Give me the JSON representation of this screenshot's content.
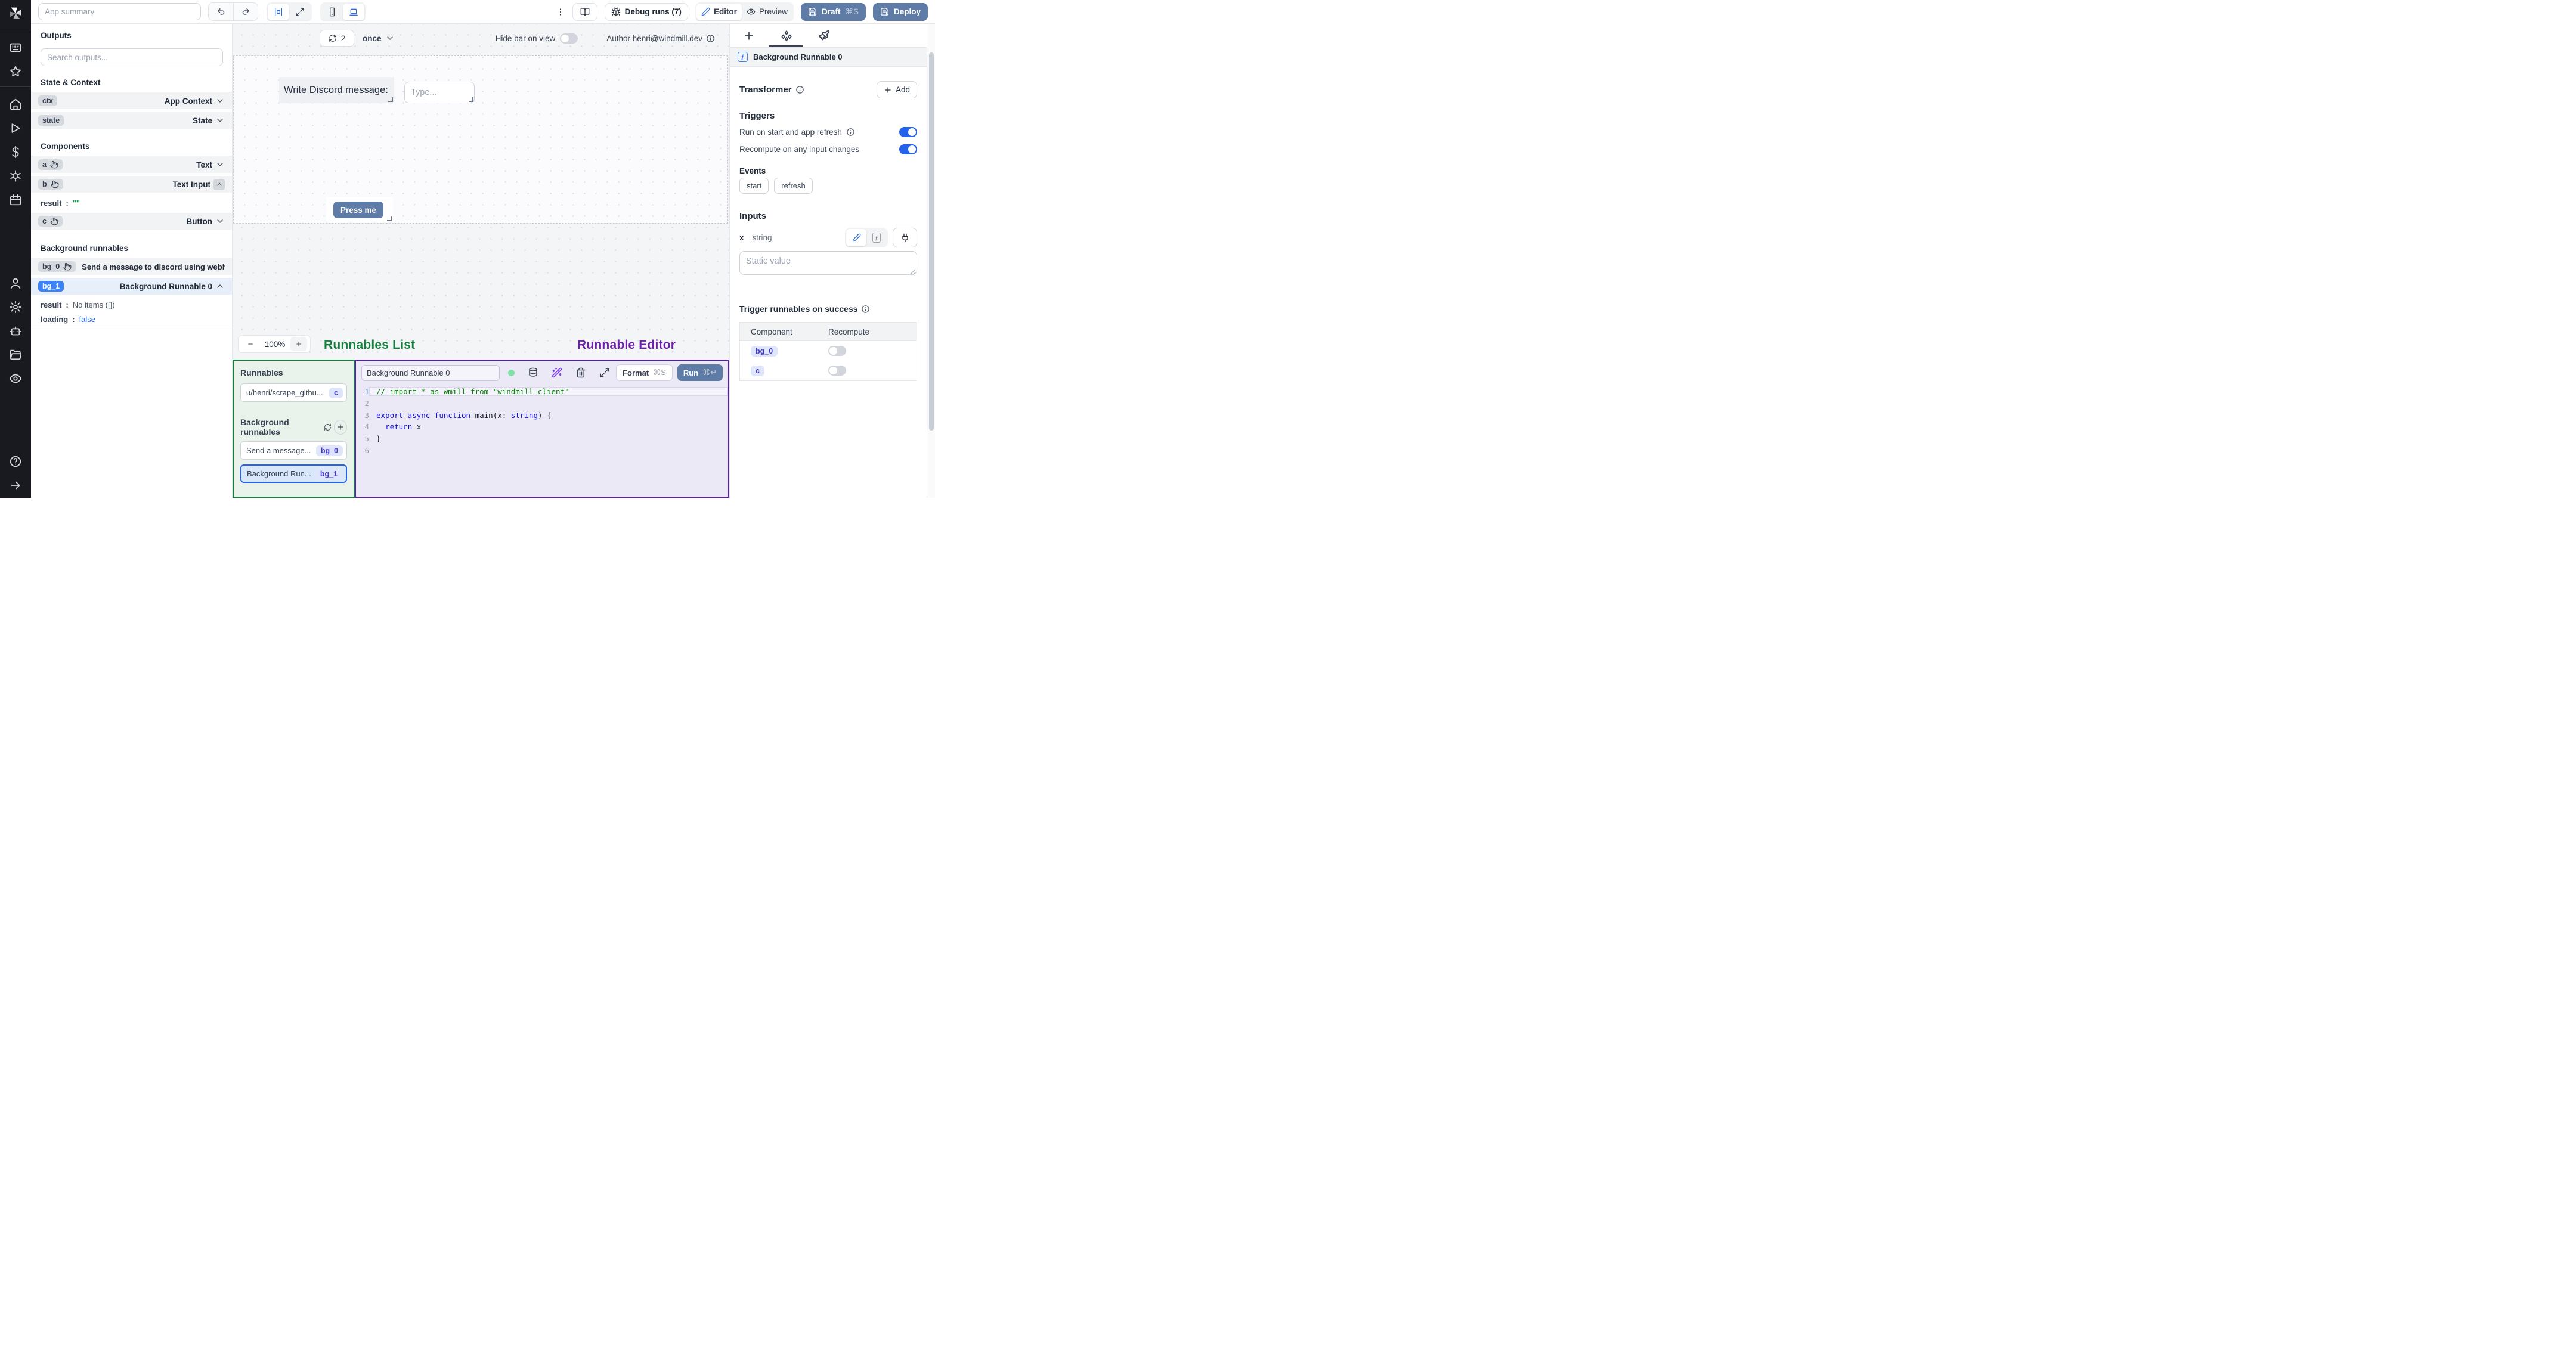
{
  "topbar": {
    "app_summary_placeholder": "App summary",
    "debug_runs_label": "Debug runs (7)",
    "editor_label": "Editor",
    "preview_label": "Preview",
    "draft_label": "Draft",
    "draft_shortcut": "⌘S",
    "deploy_label": "Deploy"
  },
  "canvas_bar": {
    "refresh_count": "2",
    "schedule": "once",
    "hide_bar_label": "Hide bar on view",
    "author_label": "Author henri@windmill.dev"
  },
  "canvas": {
    "text_component": "Write Discord message:",
    "input_placeholder": "Type...",
    "button_label": "Press me"
  },
  "zoom_control": {
    "minus": "−",
    "level": "100%",
    "plus": "+"
  },
  "annotations": {
    "runnables_list": "Runnables List",
    "runnable_editor": "Runnable Editor"
  },
  "sidebar": {
    "outputs_title": "Outputs",
    "search_placeholder": "Search outputs...",
    "state_context_title": "State & Context",
    "context_rows": [
      {
        "id": "ctx",
        "type": "App Context"
      },
      {
        "id": "state",
        "type": "State"
      }
    ],
    "components_title": "Components",
    "component_rows": [
      {
        "id": "a",
        "type": "Text"
      },
      {
        "id": "b",
        "type": "Text Input"
      },
      {
        "id": "c",
        "type": "Button"
      }
    ],
    "b_detail": {
      "key": "result",
      "sep": ":",
      "value": "\"\""
    },
    "background_title": "Background runnables",
    "bg0": {
      "id": "bg_0",
      "label": "Send a message to discord using webhoo"
    },
    "bg1": {
      "id": "bg_1",
      "label": "Background Runnable 0"
    },
    "bg1_result": {
      "key": "result",
      "sep": ":",
      "value": "No items ([])"
    },
    "bg1_loading": {
      "key": "loading",
      "sep": ":",
      "value": "false"
    }
  },
  "runnables_panel": {
    "title": "Runnables",
    "item0": {
      "label": "u/henri/scrape_githu...",
      "badge": "c"
    },
    "background_title": "Background runnables",
    "item1": {
      "label": "Send a message...",
      "badge": "bg_0"
    },
    "item2": {
      "label": "Background Run...",
      "badge": "bg_1"
    }
  },
  "editor_panel": {
    "name_value": "Background Runnable 0",
    "format_label": "Format",
    "format_shortcut": "⌘S",
    "run_label": "Run",
    "run_shortcut": "⌘↵",
    "line_numbers": [
      "1",
      "2",
      "3",
      "4",
      "5",
      "6"
    ],
    "code": {
      "line1_comment": "// import * as wmill from \"windmill-client\"",
      "line3": {
        "kw1": "export async function ",
        "fn": "main",
        "open": "(",
        "param": "x",
        "colon": ": ",
        "type": "string",
        "close": ") {"
      },
      "line4": {
        "indent": "  ",
        "kw": "return",
        "rest": " x"
      },
      "line5": "}"
    }
  },
  "right_panel": {
    "selected_runnable": "Background Runnable 0",
    "transformer_title": "Transformer",
    "add_label": "Add",
    "triggers_title": "Triggers",
    "trigger_rows": [
      {
        "label": "Run on start and app refresh"
      },
      {
        "label": "Recompute on any input changes"
      }
    ],
    "events_title": "Events",
    "events": [
      "start",
      "refresh"
    ],
    "inputs_title": "Inputs",
    "input_name": "x",
    "input_type": "string",
    "static_placeholder": "Static value",
    "trigger_success_title": "Trigger runnables on success",
    "table": {
      "col_component": "Component",
      "col_recompute": "Recompute",
      "rows": [
        {
          "badge": "bg_0"
        },
        {
          "badge": "c"
        }
      ]
    }
  }
}
